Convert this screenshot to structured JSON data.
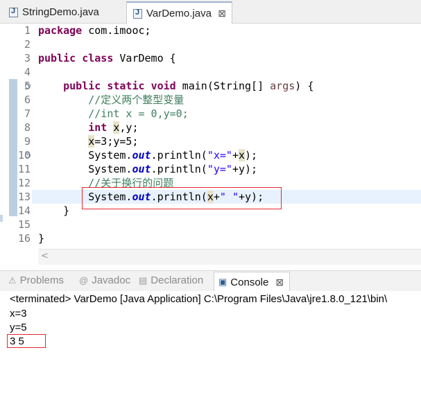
{
  "editor": {
    "tabs": [
      {
        "label": "StringDemo.java",
        "active": false
      },
      {
        "label": "VarDemo.java",
        "active": true
      }
    ],
    "close_glyph": "⊠",
    "lines": [
      {
        "num": "1"
      },
      {
        "num": "2"
      },
      {
        "num": "3"
      },
      {
        "num": "4"
      },
      {
        "num": "5"
      },
      {
        "num": "6"
      },
      {
        "num": "7"
      },
      {
        "num": "8"
      },
      {
        "num": "9"
      },
      {
        "num": "10"
      },
      {
        "num": "11"
      },
      {
        "num": "12"
      },
      {
        "num": "13"
      },
      {
        "num": "14"
      },
      {
        "num": "15"
      },
      {
        "num": "16"
      }
    ],
    "code": {
      "l1_kw": "package",
      "l1_rest": " com.imooc;",
      "l3_kw1": "public",
      "l3_kw2": "class",
      "l3_rest": " VarDemo {",
      "l5_kw1": "public",
      "l5_kw2": "static",
      "l5_kw3": "void",
      "l5_mid": " main(String[] ",
      "l5_param": "args",
      "l5_end": ") {",
      "l6_comment": "//定义两个整型变量",
      "l7_comment": "//int x = 0,y=0;",
      "l8_kw": "int",
      "l8_x": "x",
      "l8_rest": ",y;",
      "l9_x": "x",
      "l9_rest": "=3;y=5;",
      "l10_a": "System.",
      "l10_out": "out",
      "l10_b": ".println(",
      "l10_str": "\"x=\"",
      "l10_plus": "+",
      "l10_x": "x",
      "l10_end": ");",
      "l11_a": "System.",
      "l11_out": "out",
      "l11_b": ".println(",
      "l11_str": "\"y=\"",
      "l11_end": "+y);",
      "l12_comment": "//关于换行的问题",
      "l13_a": "System.",
      "l13_out": "out",
      "l13_b": ".println(",
      "l13_x": "x",
      "l13_plus": "+",
      "l13_str": "\" \"",
      "l13_end": "+y);",
      "l14": "}",
      "l16": "}"
    }
  },
  "console": {
    "tabs": [
      {
        "label": "Problems",
        "icon": "problems-icon",
        "glyph": "⚠"
      },
      {
        "label": "Javadoc",
        "icon": "javadoc-icon",
        "glyph": "@"
      },
      {
        "label": "Declaration",
        "icon": "declaration-icon",
        "glyph": "▤"
      },
      {
        "label": "Console",
        "icon": "console-icon",
        "glyph": "▣",
        "active": true
      }
    ],
    "close_glyph": "⊠",
    "header": "<terminated> VarDemo [Java Application] C:\\Program Files\\Java\\jre1.8.0_121\\bin\\",
    "output": [
      "x=3",
      "y=5",
      "3 5"
    ]
  },
  "colors": {
    "keyword": "#7f0055",
    "comment": "#3f7f5f",
    "string": "#2a00ff",
    "field": "#0000c0",
    "highlight_box": "#e3272f"
  }
}
